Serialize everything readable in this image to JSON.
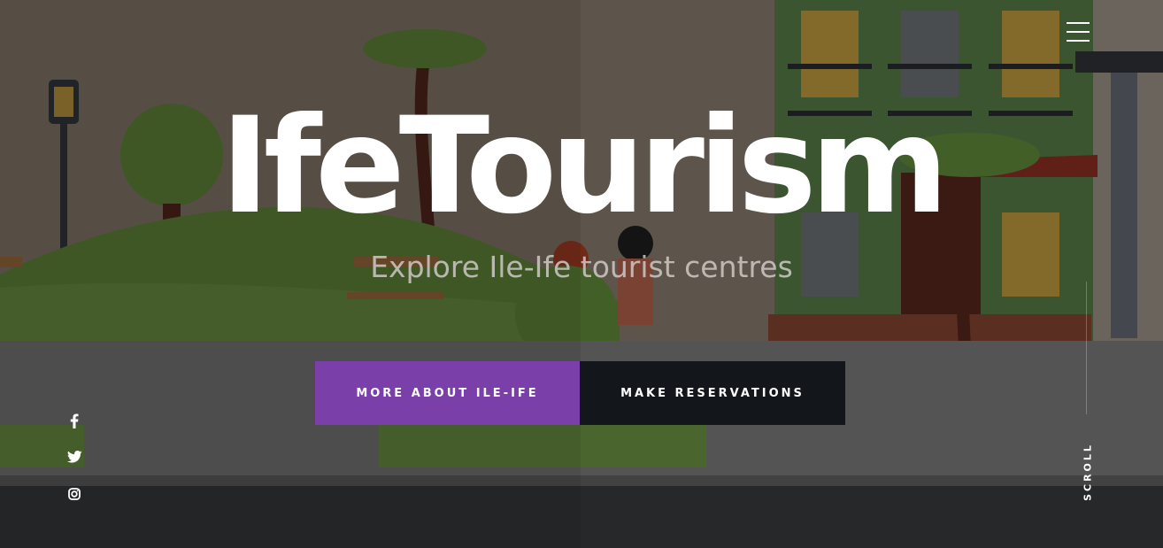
{
  "hero": {
    "title": "IfeTourism",
    "subtitle": "Explore Ile-Ife tourist centres"
  },
  "buttons": {
    "about": "MORE ABOUT ILE-IFE",
    "reservations": "MAKE RESERVATIONS"
  },
  "scroll": {
    "label": "SCROLL"
  },
  "social": [
    {
      "icon": "facebook-icon"
    },
    {
      "icon": "twitter-icon"
    },
    {
      "icon": "instagram-icon"
    }
  ],
  "colors": {
    "accent": "#7a3fa8",
    "dark_button": "#13171c",
    "overlay": "rgba(0,0,0,0.5)"
  }
}
